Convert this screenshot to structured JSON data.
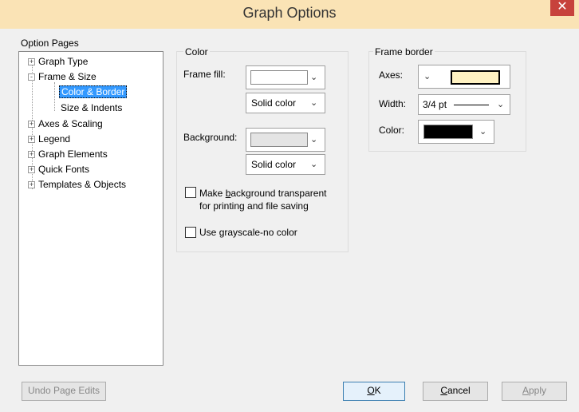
{
  "window": {
    "title": "Graph Options",
    "close_glyph": "✕"
  },
  "option_pages": {
    "label": "Option Pages",
    "items": [
      {
        "label": "Graph Type",
        "expander": "+"
      },
      {
        "label": "Frame & Size",
        "expander": "-"
      },
      {
        "label": "Color & Border",
        "selected": true
      },
      {
        "label": "Size & Indents"
      },
      {
        "label": "Axes & Scaling",
        "expander": "+"
      },
      {
        "label": "Legend",
        "expander": "+"
      },
      {
        "label": "Graph Elements",
        "expander": "+"
      },
      {
        "label": "Quick Fonts",
        "expander": "+"
      },
      {
        "label": "Templates & Objects",
        "expander": "+"
      }
    ]
  },
  "color_group": {
    "label": "Color",
    "frame_fill_label": "Frame fill:",
    "frame_fill_color": "#ffffff",
    "frame_fill_style": "Solid color",
    "background_label": "Background:",
    "background_color": "#e4e4e4",
    "background_style": "Solid color",
    "transparent_label_prefix": "Make ",
    "transparent_label_underlined": "b",
    "transparent_label_rest": "ackground transparent",
    "transparent_label_line2": "for printing and file saving",
    "grayscale_label_prefix": "Use ",
    "grayscale_label_underlined": "g",
    "grayscale_label_rest": "rayscale-no color"
  },
  "frame_border": {
    "label": "Frame border",
    "axes_label": "Axes:",
    "axes_color": "#fff2c2",
    "width_label": "Width:",
    "width_value": "3/4 pt",
    "color_label": "Color:",
    "border_color": "#000000"
  },
  "buttons": {
    "undo": "Undo Page Edits",
    "ok_u": "O",
    "ok_rest": "K",
    "cancel_u": "C",
    "cancel_rest": "ancel",
    "apply_u": "A",
    "apply_rest": "pply"
  }
}
